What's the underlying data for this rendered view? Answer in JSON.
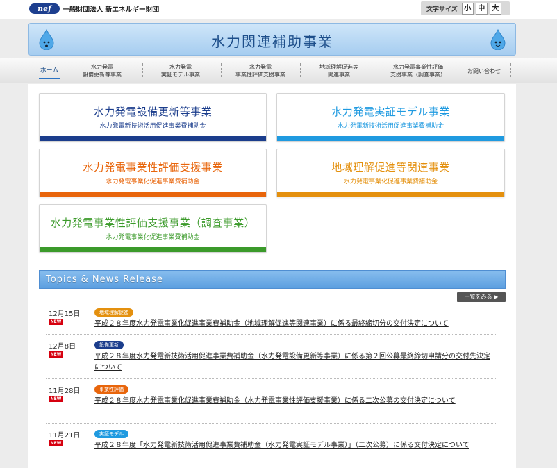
{
  "header": {
    "logo_mark": "nef",
    "org_name": "一般財団法人 新エネルギー財団",
    "font_size_label": "文字サイズ",
    "font_sizes": [
      "小",
      "中",
      "大"
    ]
  },
  "banner": {
    "title": "水力関連補助事業"
  },
  "nav": {
    "home": "ホーム",
    "items": [
      {
        "line1": "水力発電",
        "line2": "設備更新等事業"
      },
      {
        "line1": "水力発電",
        "line2": "実証モデル事業"
      },
      {
        "line1": "水力発電",
        "line2": "事業性評価支援事業"
      },
      {
        "line1": "地域理解促進等",
        "line2": "関連事業"
      },
      {
        "line1": "水力発電事業性評価",
        "line2": "支援事業（調査事業）"
      }
    ],
    "contact": "お問い合わせ"
  },
  "cards": [
    {
      "title": "水力発電設備更新等事業",
      "subtitle": "水力発電新技術活用促進事業費補助金",
      "color": "#1b3d8c"
    },
    {
      "title": "水力発電実証モデル事業",
      "subtitle": "水力発電新技術活用促進事業費補助金",
      "color": "#1f9ae0"
    },
    {
      "title": "水力発電事業性評価支援事業",
      "subtitle": "水力発電事業化促進事業費補助金",
      "color": "#e8650b"
    },
    {
      "title": "地域理解促進等関連事業",
      "subtitle": "水力発電事業化促進事業費補助金",
      "color": "#e4900e"
    },
    {
      "title": "水力発電事業性評価支援事業（調査事業）",
      "subtitle": "水力発電事業化促進事業費補助金",
      "color": "#3b9a2a"
    }
  ],
  "topics": {
    "title": "Topics & News Release",
    "more": "一覧をみる ▶"
  },
  "news": [
    {
      "date": "12月15日",
      "new": "NEW",
      "badge": "地域理解促進",
      "badge_color": "#e4900e",
      "text": "平成２８年度水力発電事業化促進事業費補助金（地域理解促進等関連事業）に係る最終締切分の交付決定について"
    },
    {
      "date": "12月8日",
      "new": "NEW",
      "badge": "設備更新",
      "badge_color": "#1b3d8c",
      "text": "平成２８年度水力発電新技術活用促進事業費補助金（水力発電設備更新等事業）に係る第２回公募最終締切申請分の交付先決定について"
    },
    {
      "date": "11月28日",
      "new": "NEW",
      "badge": "事業性評価",
      "badge_color": "#e8650b",
      "text": "平成２８年度水力発電事業化促進事業費補助金（水力発電事業性評価支援事業）に係る二次公募の交付決定について"
    },
    {
      "date": "11月21日",
      "new": "NEW",
      "badge": "実証モデル",
      "badge_color": "#1f9ae0",
      "text": "平成２８年度「水力発電新技術活用促進事業費補助金（水力発電実証モデル事業）」（二次公募）に係る交付決定について"
    }
  ]
}
